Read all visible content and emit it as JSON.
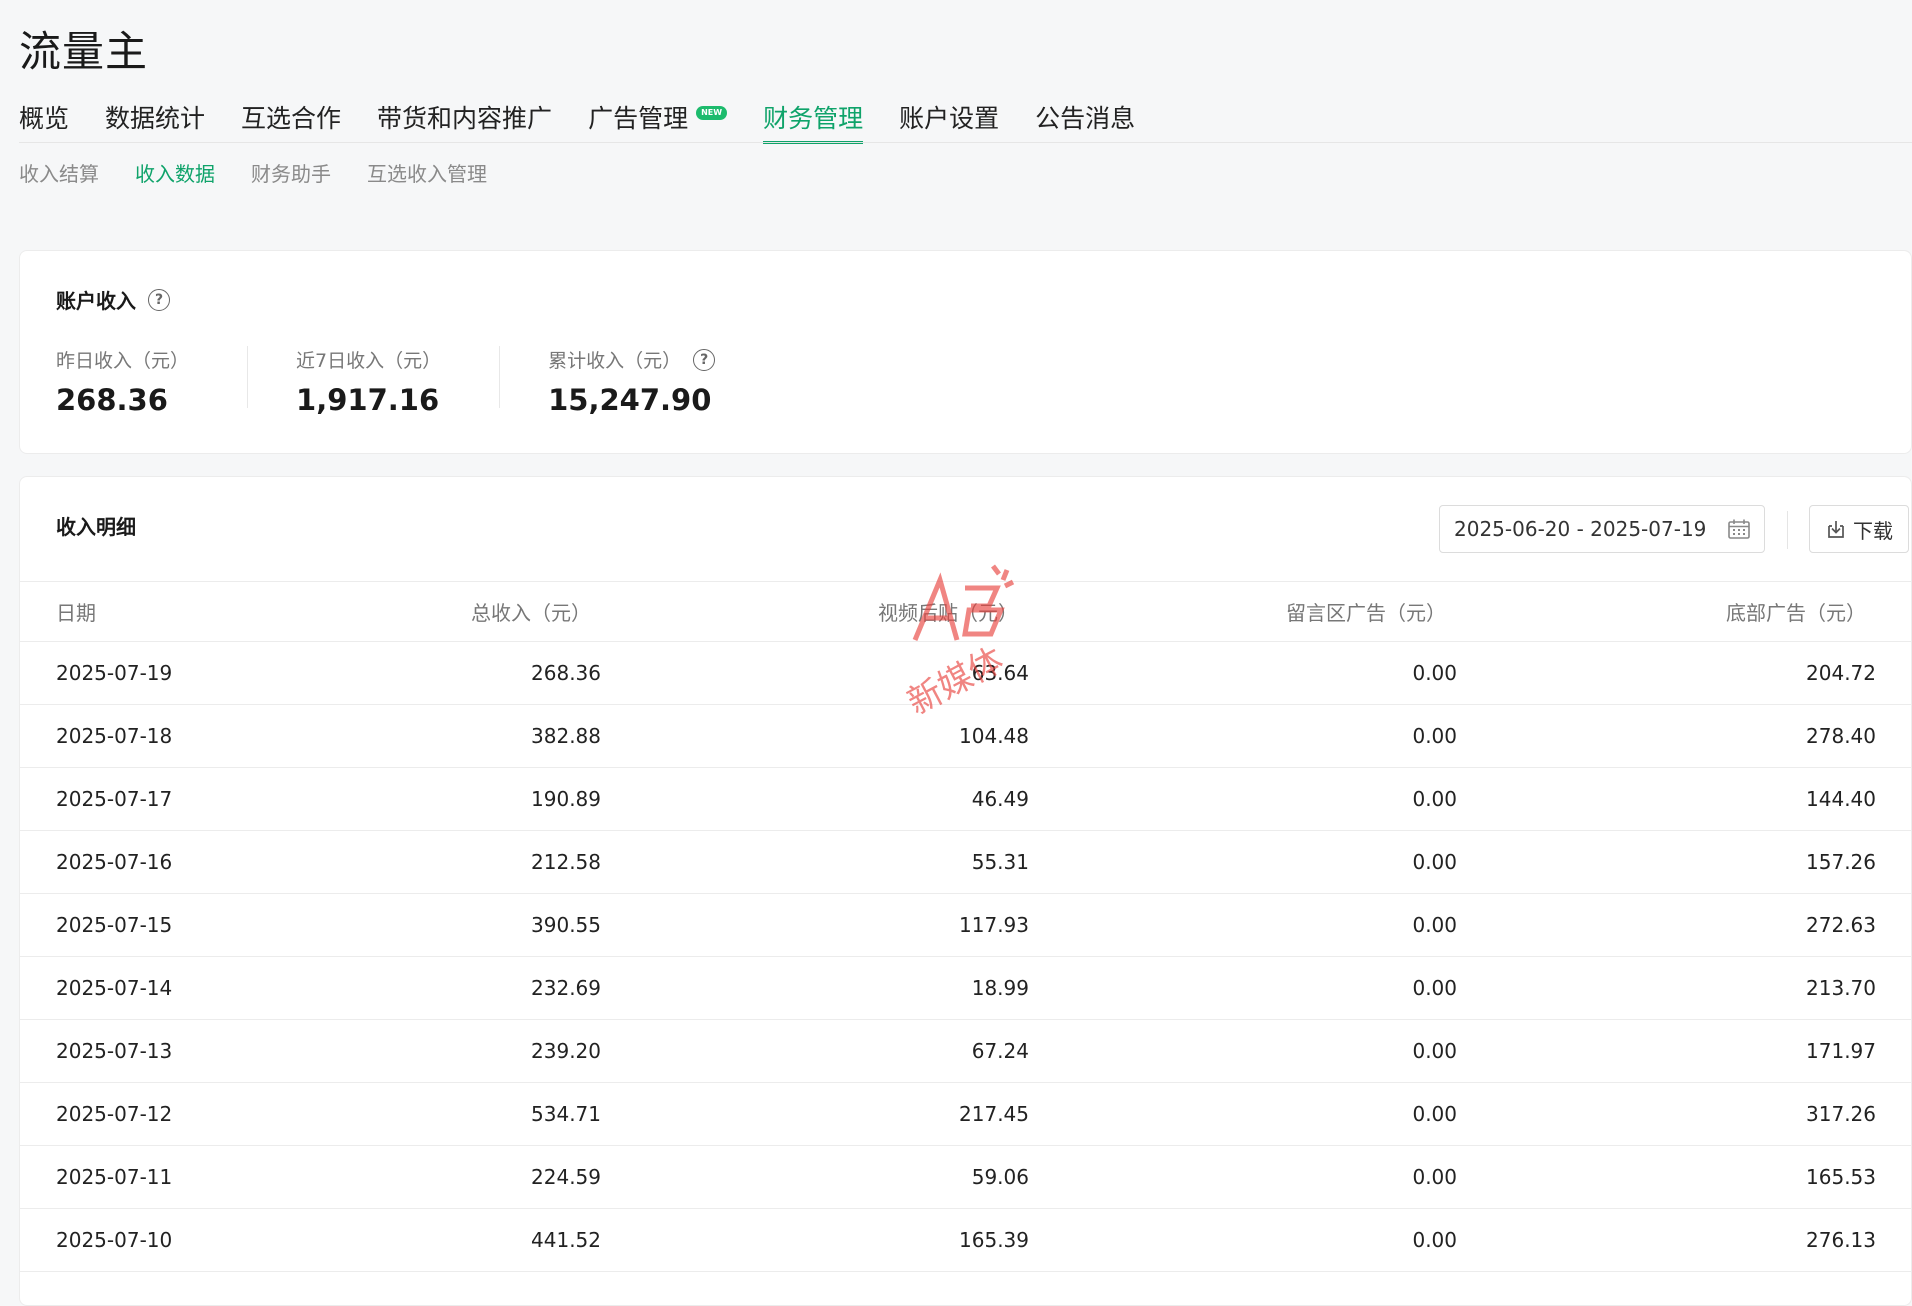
{
  "app": {
    "title": "流量主"
  },
  "main_nav": [
    {
      "label": "概览"
    },
    {
      "label": "数据统计"
    },
    {
      "label": "互选合作"
    },
    {
      "label": "带货和内容推广"
    },
    {
      "label": "广告管理",
      "badge": "NEW"
    },
    {
      "label": "财务管理",
      "active": true
    },
    {
      "label": "账户设置"
    },
    {
      "label": "公告消息"
    }
  ],
  "sub_nav": [
    {
      "label": "收入结算"
    },
    {
      "label": "收入数据",
      "active": true
    },
    {
      "label": "财务助手"
    },
    {
      "label": "互选收入管理"
    }
  ],
  "summary": {
    "title": "账户收入",
    "stats": [
      {
        "label": "昨日收入（元）",
        "value": "268.36"
      },
      {
        "label": "近7日收入（元）",
        "value": "1,917.16"
      },
      {
        "label": "累计收入（元）",
        "value": "15,247.90"
      }
    ]
  },
  "detail": {
    "title": "收入明细",
    "date_range": "2025-06-20 - 2025-07-19",
    "download_label": "下载",
    "columns": [
      "日期",
      "总收入（元）",
      "视频后贴（元）",
      "留言区广告（元）",
      "底部广告（元）"
    ],
    "rows": [
      [
        "2025-07-19",
        "268.36",
        "63.64",
        "0.00",
        "204.72"
      ],
      [
        "2025-07-18",
        "382.88",
        "104.48",
        "0.00",
        "278.40"
      ],
      [
        "2025-07-17",
        "190.89",
        "46.49",
        "0.00",
        "144.40"
      ],
      [
        "2025-07-16",
        "212.58",
        "55.31",
        "0.00",
        "157.26"
      ],
      [
        "2025-07-15",
        "390.55",
        "117.93",
        "0.00",
        "272.63"
      ],
      [
        "2025-07-14",
        "232.69",
        "18.99",
        "0.00",
        "213.70"
      ],
      [
        "2025-07-13",
        "239.20",
        "67.24",
        "0.00",
        "171.97"
      ],
      [
        "2025-07-12",
        "534.71",
        "217.45",
        "0.00",
        "317.26"
      ],
      [
        "2025-07-11",
        "224.59",
        "59.06",
        "0.00",
        "165.53"
      ],
      [
        "2025-07-10",
        "441.52",
        "165.39",
        "0.00",
        "276.13"
      ]
    ]
  },
  "watermark": {
    "text": "新媒体"
  },
  "colors": {
    "accent": "#0fa36a",
    "badge": "#1dbb6d",
    "watermark": "#e8413c"
  }
}
